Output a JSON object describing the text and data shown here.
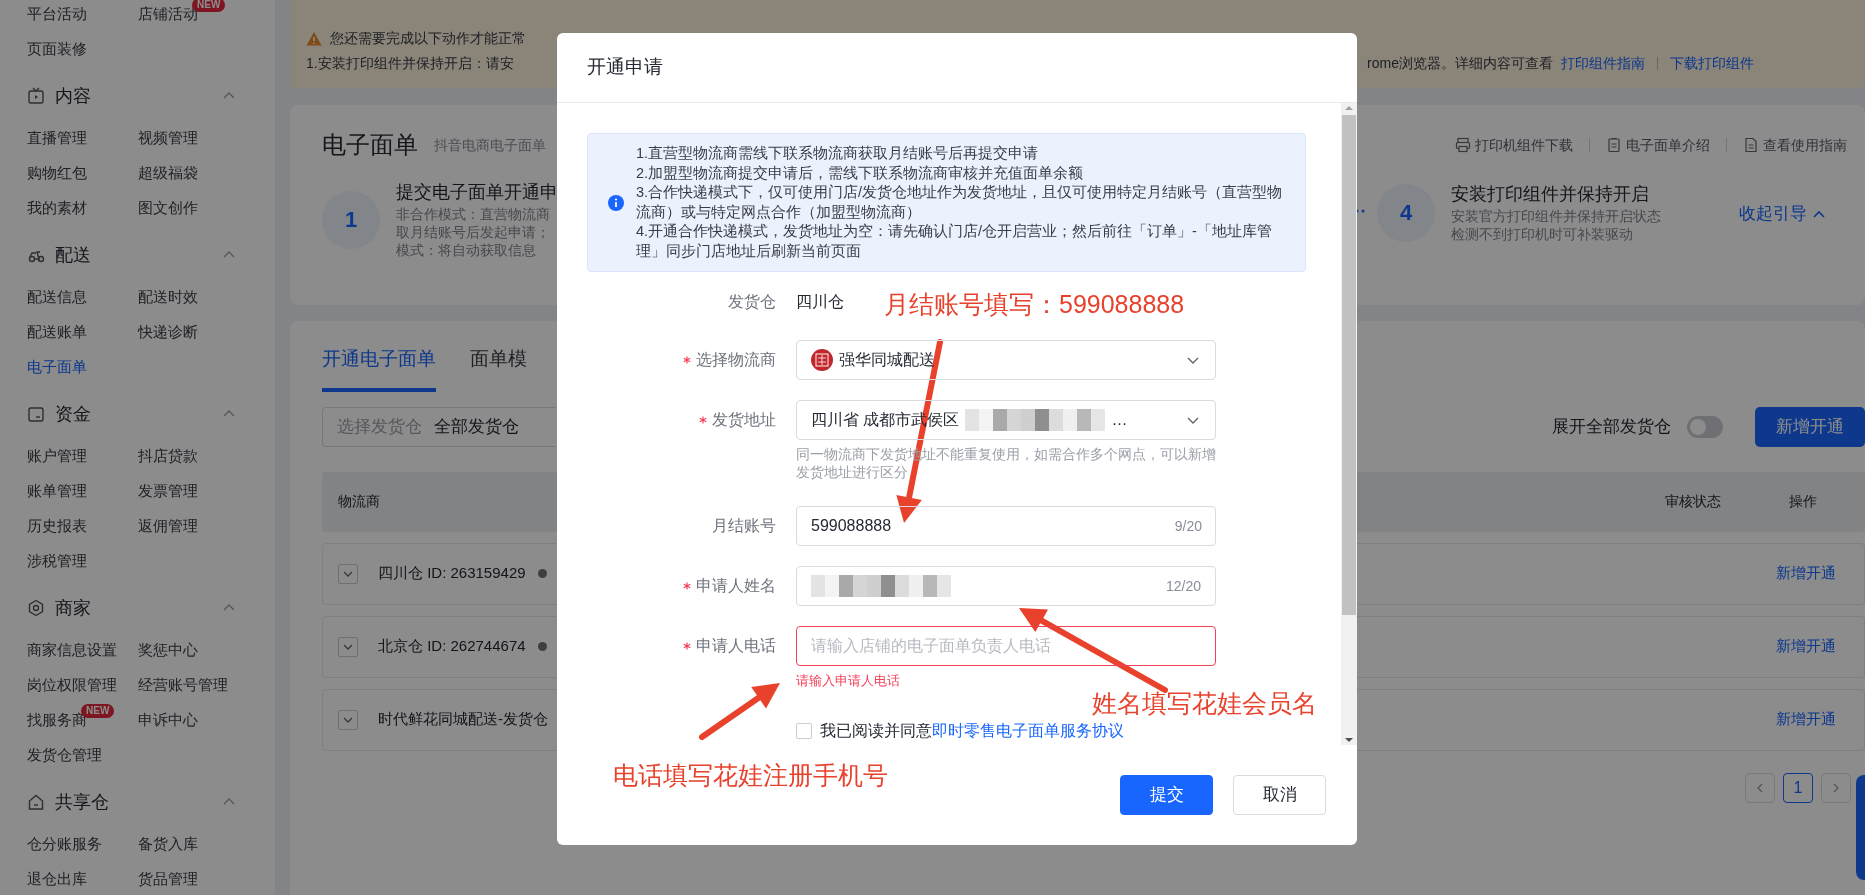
{
  "sidebar": {
    "top_items": [
      {
        "label": "平台活动",
        "selected": false
      },
      {
        "label": "店铺活动",
        "selected": false,
        "badge": "NEW"
      },
      {
        "label": "页面装修",
        "selected": false
      }
    ],
    "groups": [
      {
        "title": "内容",
        "expanded": true,
        "items": [
          {
            "label": "直播管理",
            "selected": false
          },
          {
            "label": "视频管理",
            "selected": false
          },
          {
            "label": "购物红包",
            "selected": false
          },
          {
            "label": "超级福袋",
            "selected": false
          },
          {
            "label": "我的素材",
            "selected": false
          },
          {
            "label": "图文创作",
            "selected": false
          }
        ]
      },
      {
        "title": "配送",
        "expanded": true,
        "items": [
          {
            "label": "配送信息",
            "selected": false
          },
          {
            "label": "配送时效",
            "selected": false
          },
          {
            "label": "配送账单",
            "selected": false
          },
          {
            "label": "快递诊断",
            "selected": false
          },
          {
            "label": "电子面单",
            "selected": true
          }
        ]
      },
      {
        "title": "资金",
        "expanded": true,
        "items": [
          {
            "label": "账户管理",
            "selected": false
          },
          {
            "label": "抖店贷款",
            "selected": false
          },
          {
            "label": "账单管理",
            "selected": false
          },
          {
            "label": "发票管理",
            "selected": false
          },
          {
            "label": "历史报表",
            "selected": false
          },
          {
            "label": "返佣管理",
            "selected": false
          },
          {
            "label": "涉税管理",
            "selected": false
          }
        ]
      },
      {
        "title": "商家",
        "expanded": true,
        "items": [
          {
            "label": "商家信息设置",
            "selected": false
          },
          {
            "label": "奖惩中心",
            "selected": false
          },
          {
            "label": "岗位权限管理",
            "selected": false
          },
          {
            "label": "经营账号管理",
            "selected": false
          },
          {
            "label": "找服务商",
            "selected": false,
            "badge": "NEW"
          },
          {
            "label": "申诉中心",
            "selected": false
          },
          {
            "label": "发货仓管理",
            "selected": false
          }
        ]
      },
      {
        "title": "共享仓",
        "expanded": true,
        "items": [
          {
            "label": "仓分账服务",
            "selected": false
          },
          {
            "label": "备货入库",
            "selected": false
          },
          {
            "label": "退仓出库",
            "selected": false
          },
          {
            "label": "货品管理",
            "selected": false
          }
        ]
      }
    ]
  },
  "notice": {
    "heading": "您还需要完成以下动作才能正常",
    "step_left": "1.安装打印组件并保持开启：请安",
    "step_right": "rome浏览器。详细内容可查看",
    "links": [
      "打印组件指南",
      "下载打印组件"
    ]
  },
  "header": {
    "title": "电子面单",
    "subtitle": "抖音电商电子面单",
    "tools": [
      "打印机组件下载",
      "电子面单介绍",
      "查看使用指南"
    ]
  },
  "steps": [
    {
      "number": "1",
      "title": "提交电子面单开通申",
      "lines": [
        "非合作模式：直营物流商",
        "取月结账号后发起申请；",
        "模式：将自动获取信息"
      ]
    },
    {
      "number": "4",
      "title": "安装打印组件并保持开启",
      "lines": [
        "安装官方打印组件并保持开启状态",
        "检测不到打印机时可补装驱动"
      ]
    }
  ],
  "collapse_link": "收起引导",
  "tabs": [
    {
      "label": "开通电子面单",
      "selected": true
    },
    {
      "label": "面单模",
      "selected": false
    }
  ],
  "filter": {
    "label": "选择发货仓",
    "value": "全部发货仓"
  },
  "expand_toggle": {
    "label": "展开全部发货仓",
    "on": false
  },
  "add_button": "新增开通",
  "table": {
    "columns": [
      "物流商",
      "审核状态",
      "操作"
    ],
    "rows": [
      {
        "name": "四川仓 ID: 263159429",
        "status_dot": true,
        "action": "新增开通",
        "expanded": false
      },
      {
        "name": "北京仓 ID: 262744674",
        "status_dot": true,
        "action": "新增开通",
        "expanded": false
      },
      {
        "name": "时代鲜花同城配送-发货仓",
        "status_dot": false,
        "action": "新增开通",
        "expanded": false
      }
    ]
  },
  "pagination": {
    "pages": [
      {
        "label": "1",
        "selected": true
      }
    ]
  },
  "modal": {
    "title": "开通申请",
    "notice_lines": [
      "1.直营型物流商需线下联系物流商获取月结账号后再提交申请",
      "2.加盟型物流商提交申请后，需线下联系物流商审核并充值面单余额",
      "3.合作快递模式下，仅可使用门店/发货仓地址作为发货地址，且仅可使用特定月结账号（直营型物流商）或与特定网点合作（加盟型物流商）",
      "4.开通合作快递模式，发货地址为空：请先确认门店/仓开启营业；然后前往「订单」-「地址库管理」同步门店地址后刷新当前页面"
    ],
    "fields": [
      {
        "kind": "static",
        "label": "发货仓",
        "required": false,
        "value": "四川仓"
      },
      {
        "kind": "select",
        "label": "选择物流商",
        "required": true,
        "value": "强华同城配送",
        "logo": true
      },
      {
        "kind": "select",
        "label": "发货地址",
        "required": true,
        "value": "四川省 成都市武侯区",
        "redacted": true,
        "tail": "…",
        "hint": "同一物流商下发货地址不能重复使用，如需合作多个网点，可以新增发货地址进行区分"
      },
      {
        "kind": "text",
        "label": "月结账号",
        "required": false,
        "value": "599088888",
        "counter": "9/20"
      },
      {
        "kind": "text",
        "label": "申请人姓名",
        "required": true,
        "redacted": true,
        "counter": "12/20"
      },
      {
        "kind": "text",
        "label": "申请人电话",
        "required": true,
        "placeholder": "请输入店铺的电子面单负责人电话",
        "invalid": true,
        "error": "请输入申请人电话"
      }
    ],
    "agreement": {
      "text": "我已阅读并同意",
      "link": "即时零售电子面单服务协议",
      "checked": false
    },
    "buttons": [
      {
        "label": "提交",
        "kind": "primary"
      },
      {
        "label": "取消",
        "kind": "secondary"
      }
    ]
  },
  "annotations": [
    {
      "text": "月结账号填写：599088888"
    },
    {
      "text": "姓名填写花娃会员名"
    },
    {
      "text": "电话填写花娃注册手机号"
    }
  ]
}
